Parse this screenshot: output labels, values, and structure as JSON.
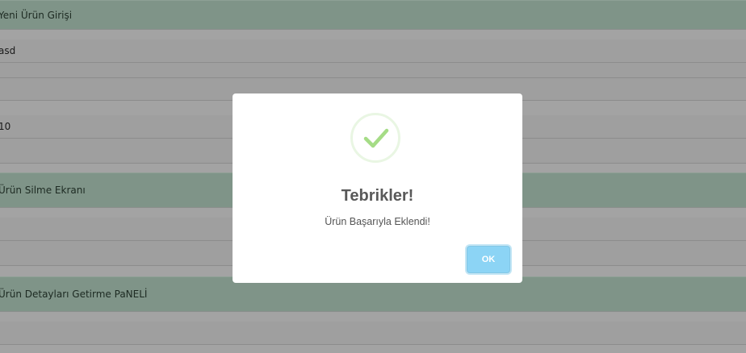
{
  "background": {
    "panels": [
      {
        "title": "Yeni Ürün Girişi"
      },
      {
        "title": "Ürün Silme Ekranı"
      },
      {
        "title": "Ürün Detayları Getirme PaNELİ"
      }
    ],
    "rows": {
      "name_value": "asd",
      "empty_value_1": "",
      "empty_value_2": "",
      "number_value": "10",
      "empty_value_3": ""
    }
  },
  "dialog": {
    "icon": "checkmark-success-icon",
    "title": "Tebrikler!",
    "message": "Ürün Başarıyla Eklendi!",
    "ok_label": "OK",
    "colors": {
      "check": "#a5dc86",
      "ring": "#e9f6e3",
      "ok_button": "#8cd4f5",
      "panel_header": "#7f9488",
      "overlay": "#9e9e9e"
    }
  }
}
